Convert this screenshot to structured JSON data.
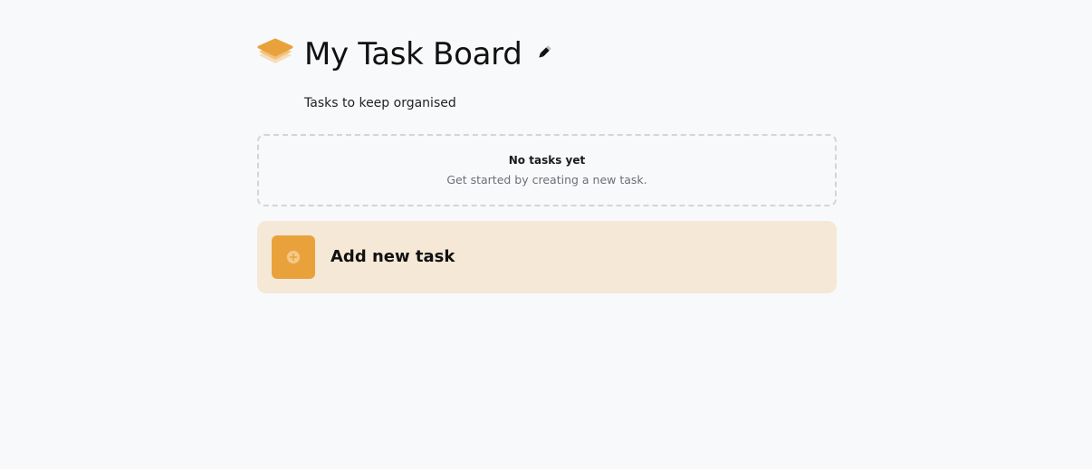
{
  "board": {
    "title": "My Task Board",
    "description": "Tasks to keep organised",
    "logo_icon": "stacked-layers-icon",
    "edit_icon": "pencil-icon"
  },
  "empty_state": {
    "title": "No tasks yet",
    "description": "Get started by creating a new task."
  },
  "add_task": {
    "label": "Add new task",
    "icon": "plus-circle-icon"
  },
  "colors": {
    "background": "#f8f9fb",
    "accent": "#e9a23b",
    "accent_light": "#f5e8d7",
    "muted_text": "#6b6f76"
  }
}
